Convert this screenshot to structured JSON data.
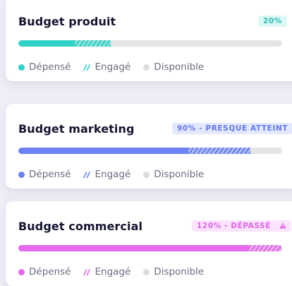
{
  "cards": [
    {
      "title": "Budget produit",
      "badge": "20%",
      "spent_percent": 21.5,
      "engaged_percent": 13.5,
      "color": "#2ed3c6",
      "badge_bg": "#dcf8f5",
      "badge_text": "#2bbfb3",
      "legend": {
        "spent": "Dépensé",
        "engaged": "Engagé",
        "available": "Disponible"
      }
    },
    {
      "title": "Budget marketing",
      "badge": "90% - PRESQUE ATTEINT",
      "spent_percent": 64.5,
      "engaged_percent": 23.5,
      "color": "#6b82f2",
      "badge_bg": "#e4e8ff",
      "badge_text": "#6379e8",
      "legend": {
        "spent": "Dépensé",
        "engaged": "Engagé",
        "available": "Disponible"
      }
    },
    {
      "title": "Budget commercial",
      "badge": "120% - DÉPASSÉ",
      "badge_icon": "warning-icon",
      "spent_percent": 87.5,
      "engaged_percent": 12.5,
      "color": "#e569ee",
      "badge_bg": "#fbe4fd",
      "badge_text": "#df63e9",
      "legend": {
        "spent": "Dépensé",
        "engaged": "Engagé",
        "available": "Disponible"
      }
    }
  ],
  "legend_available_color": "#dcdce0",
  "track_color": "#e5e5e8"
}
